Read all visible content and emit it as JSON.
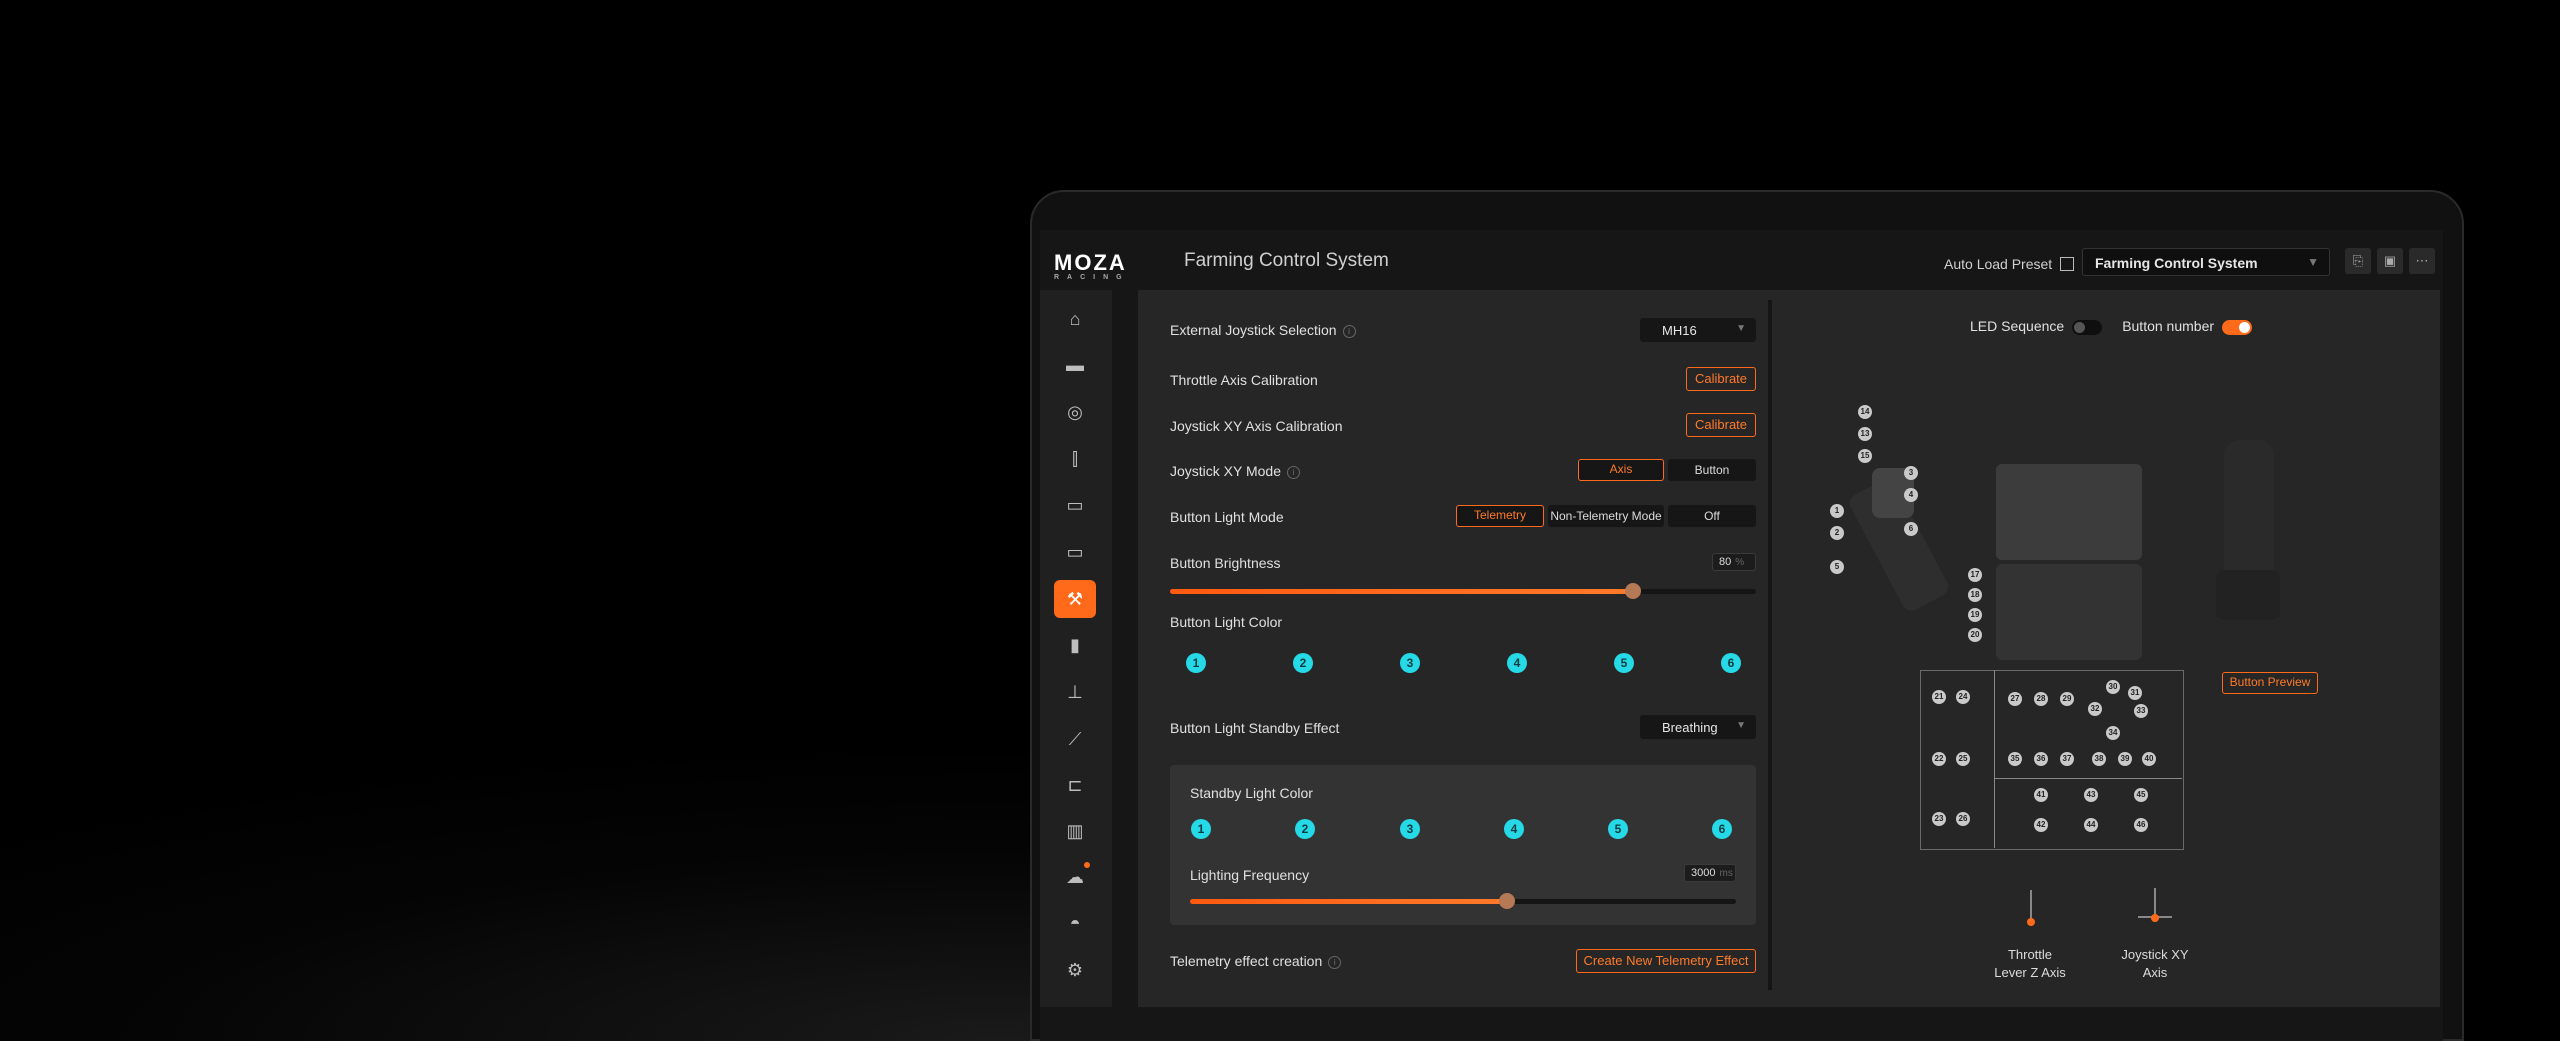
{
  "brand": {
    "name": "MOZA",
    "sub": "RACING"
  },
  "app_title": "Farming Control System",
  "toolbar": {
    "auto_load_label": "Auto Load Preset",
    "preset_value": "Farming Control System"
  },
  "settings": {
    "ext_joystick_label": "External Joystick Selection",
    "ext_joystick_value": "MH16",
    "throttle_cal_label": "Throttle Axis Calibration",
    "throttle_cal_btn": "Calibrate",
    "xy_cal_label": "Joystick XY Axis Calibration",
    "xy_cal_btn": "Calibrate",
    "xy_mode_label": "Joystick XY Mode",
    "xy_mode_options": [
      "Axis",
      "Button"
    ],
    "light_mode_label": "Button Light Mode",
    "light_mode_options": [
      "Telemetry",
      "Non-Telemetry Mode",
      "Off"
    ],
    "brightness_label": "Button  Brightness",
    "brightness_value": "80",
    "brightness_unit": "%",
    "brightness_level": 0.79,
    "light_color_label": "Button Light Color",
    "light_color_dots": [
      "1",
      "2",
      "3",
      "4",
      "5",
      "6"
    ],
    "standby_effect_label": "Button Light Standby Effect",
    "standby_effect_value": "Breathing",
    "standby_color_label": "Standby Light Color",
    "standby_color_dots": [
      "1",
      "2",
      "3",
      "4",
      "5",
      "6"
    ],
    "frequency_label": "Lighting Frequency",
    "frequency_value": "3000",
    "frequency_unit": "ms",
    "frequency_level": 0.58,
    "telemetry_label": "Telemetry effect creation",
    "telemetry_btn": "Create New Telemetry Effect"
  },
  "preview": {
    "led_sequence_label": "LED Sequence",
    "button_number_label": "Button number",
    "button_preview_btn": "Button Preview",
    "throttle_axis_label_1": "Throttle",
    "throttle_axis_label_2": "Lever Z Axis",
    "joystick_axis_label_1": "Joystick XY",
    "joystick_axis_label_2": "Axis",
    "left_grip_numbers": [
      "14",
      "13",
      "15",
      "3",
      "4",
      "1",
      "2",
      "6",
      "5"
    ],
    "panel_left_numbers": [
      "17",
      "18",
      "19",
      "20"
    ],
    "grid_numbers": [
      "21",
      "24",
      "27",
      "28",
      "29",
      "30",
      "31",
      "32",
      "33",
      "34",
      "35",
      "36",
      "37",
      "38",
      "39",
      "40",
      "22",
      "25",
      "23",
      "26",
      "41",
      "42",
      "43",
      "44",
      "45",
      "46"
    ]
  },
  "colors": {
    "accent": "#ff6a1a",
    "cyan": "#26d9e6"
  },
  "icons": [
    "home-icon",
    "wheelbase-icon",
    "steering-wheel-icon",
    "pedals-icon",
    "dashboard-icon",
    "shifter-bar-icon",
    "farming-icon",
    "handbrake-icon",
    "shifter-icon",
    "lever-icon",
    "stalk-icon",
    "library-icon",
    "cloud-icon",
    "helmet-icon",
    "settings-icon"
  ]
}
